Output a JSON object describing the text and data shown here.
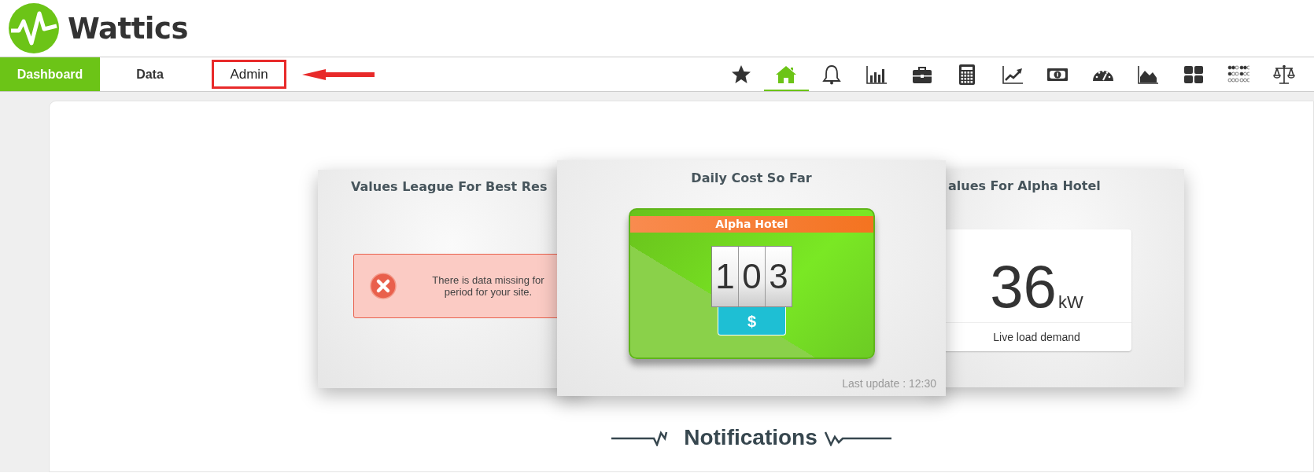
{
  "logo": {
    "text": "Wattics"
  },
  "nav": {
    "tabs": [
      {
        "label": "Dashboard",
        "selected": true,
        "highlighted": false
      },
      {
        "label": "Data",
        "selected": false,
        "highlighted": false
      },
      {
        "label": "Admin",
        "selected": false,
        "highlighted": true
      }
    ],
    "toolbar": [
      {
        "kind": "star",
        "selected": false
      },
      {
        "kind": "home",
        "selected": true
      },
      {
        "kind": "bell",
        "selected": false
      },
      {
        "kind": "bars",
        "selected": false
      },
      {
        "kind": "briefcase",
        "selected": false
      },
      {
        "kind": "calculator",
        "selected": false
      },
      {
        "kind": "trend",
        "selected": false
      },
      {
        "kind": "banknote",
        "selected": false
      },
      {
        "kind": "gauge",
        "selected": false
      },
      {
        "kind": "area",
        "selected": false
      },
      {
        "kind": "grid",
        "selected": false
      },
      {
        "kind": "dots",
        "selected": false
      },
      {
        "kind": "scales",
        "selected": false
      }
    ]
  },
  "cards": [
    {
      "kind": "alert",
      "title": "Values League For Best Res",
      "message_lines": [
        "There is data missing for",
        "period for your site."
      ]
    },
    {
      "kind": "counter",
      "title": "Daily Cost So Far",
      "site": "Alpha Hotel",
      "digits": [
        "1",
        "0",
        "3"
      ],
      "currency": "$",
      "footer": "Last update : 12:30"
    },
    {
      "kind": "load",
      "title": "alues For Alpha Hotel",
      "value": "36",
      "unit": "kW",
      "caption": "Live load demand"
    }
  ],
  "notifications": {
    "title": "Notifications"
  }
}
